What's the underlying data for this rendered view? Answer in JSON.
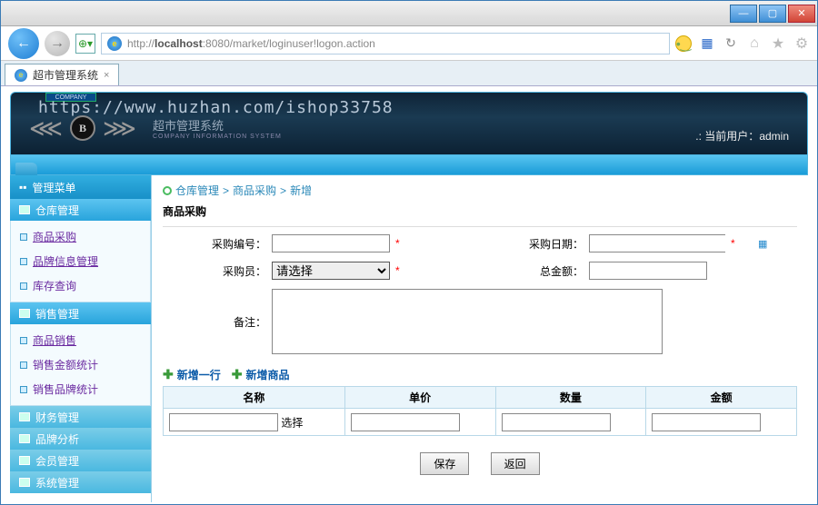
{
  "browser": {
    "tab_title": "超市管理系统",
    "url_pre": "http://",
    "url_host": "localhost",
    "url_port": ":8080",
    "url_path": "/market/loginuser!logon.action"
  },
  "header": {
    "watermark": "https://www.huzhan.com/ishop33758",
    "company_banner": "COMPANY",
    "subtitle_cn": "超市管理系统",
    "subtitle_en": "COMPANY INFORMATION SYSTEM",
    "current_user_label": ".: 当前用户：",
    "current_user": "admin"
  },
  "sidebar": {
    "menu_title": "管理菜单",
    "groups": [
      {
        "title": "仓库管理",
        "expanded": true,
        "items": [
          {
            "label": "商品采购",
            "visited": true,
            "name": "item-goods-purchase"
          },
          {
            "label": "品牌信息管理",
            "visited": true,
            "name": "item-brand-info"
          },
          {
            "label": "库存查询",
            "visited": false,
            "name": "item-stock-query"
          }
        ]
      },
      {
        "title": "销售管理",
        "expanded": true,
        "items": [
          {
            "label": "商品销售",
            "visited": true,
            "name": "item-goods-sale"
          },
          {
            "label": "销售金额统计",
            "visited": false,
            "name": "item-sale-amount"
          },
          {
            "label": "销售品牌统计",
            "visited": false,
            "name": "item-sale-brand"
          }
        ]
      },
      {
        "title": "财务管理",
        "expanded": false,
        "items": []
      },
      {
        "title": "品牌分析",
        "expanded": false,
        "items": []
      },
      {
        "title": "会员管理",
        "expanded": false,
        "items": []
      },
      {
        "title": "系统管理",
        "expanded": false,
        "items": []
      }
    ]
  },
  "breadcrumb": {
    "a": "仓库管理",
    "b": "商品采购",
    "c": "新增"
  },
  "form": {
    "section_title": "商品采购",
    "labels": {
      "purchase_no": "采购编号：",
      "purchase_date": "采购日期：",
      "purchaser": "采购员：",
      "purchaser_placeholder": "请选择",
      "total": "总金额：",
      "remark": "备注："
    }
  },
  "actions": {
    "add_row": "新增一行",
    "add_product": "新增商品"
  },
  "grid": {
    "cols": {
      "name": "名称",
      "price": "单价",
      "qty": "数量",
      "amount": "金额"
    },
    "row_select": "选择"
  },
  "buttons": {
    "save": "保存",
    "back": "返回"
  }
}
